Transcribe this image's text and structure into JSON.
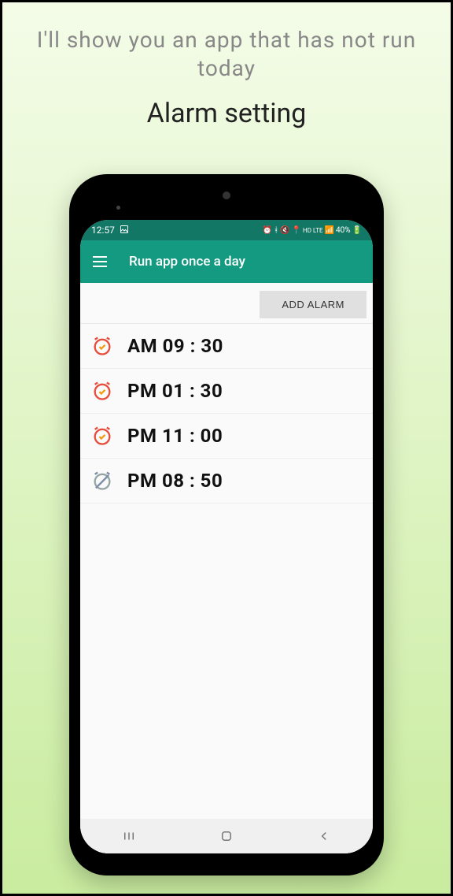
{
  "promo": {
    "text": "I'll show you an app that has not run today",
    "title": "Alarm setting"
  },
  "status": {
    "time": "12:57",
    "battery": "40%"
  },
  "appbar": {
    "title": "Run app once a day"
  },
  "add_button_label": "ADD ALARM",
  "alarms": [
    {
      "period": "AM",
      "time": "09 : 30",
      "enabled": true
    },
    {
      "period": "PM",
      "time": "01 : 30",
      "enabled": true
    },
    {
      "period": "PM",
      "time": "11 : 00",
      "enabled": true
    },
    {
      "period": "PM",
      "time": "08 : 50",
      "enabled": false
    }
  ]
}
